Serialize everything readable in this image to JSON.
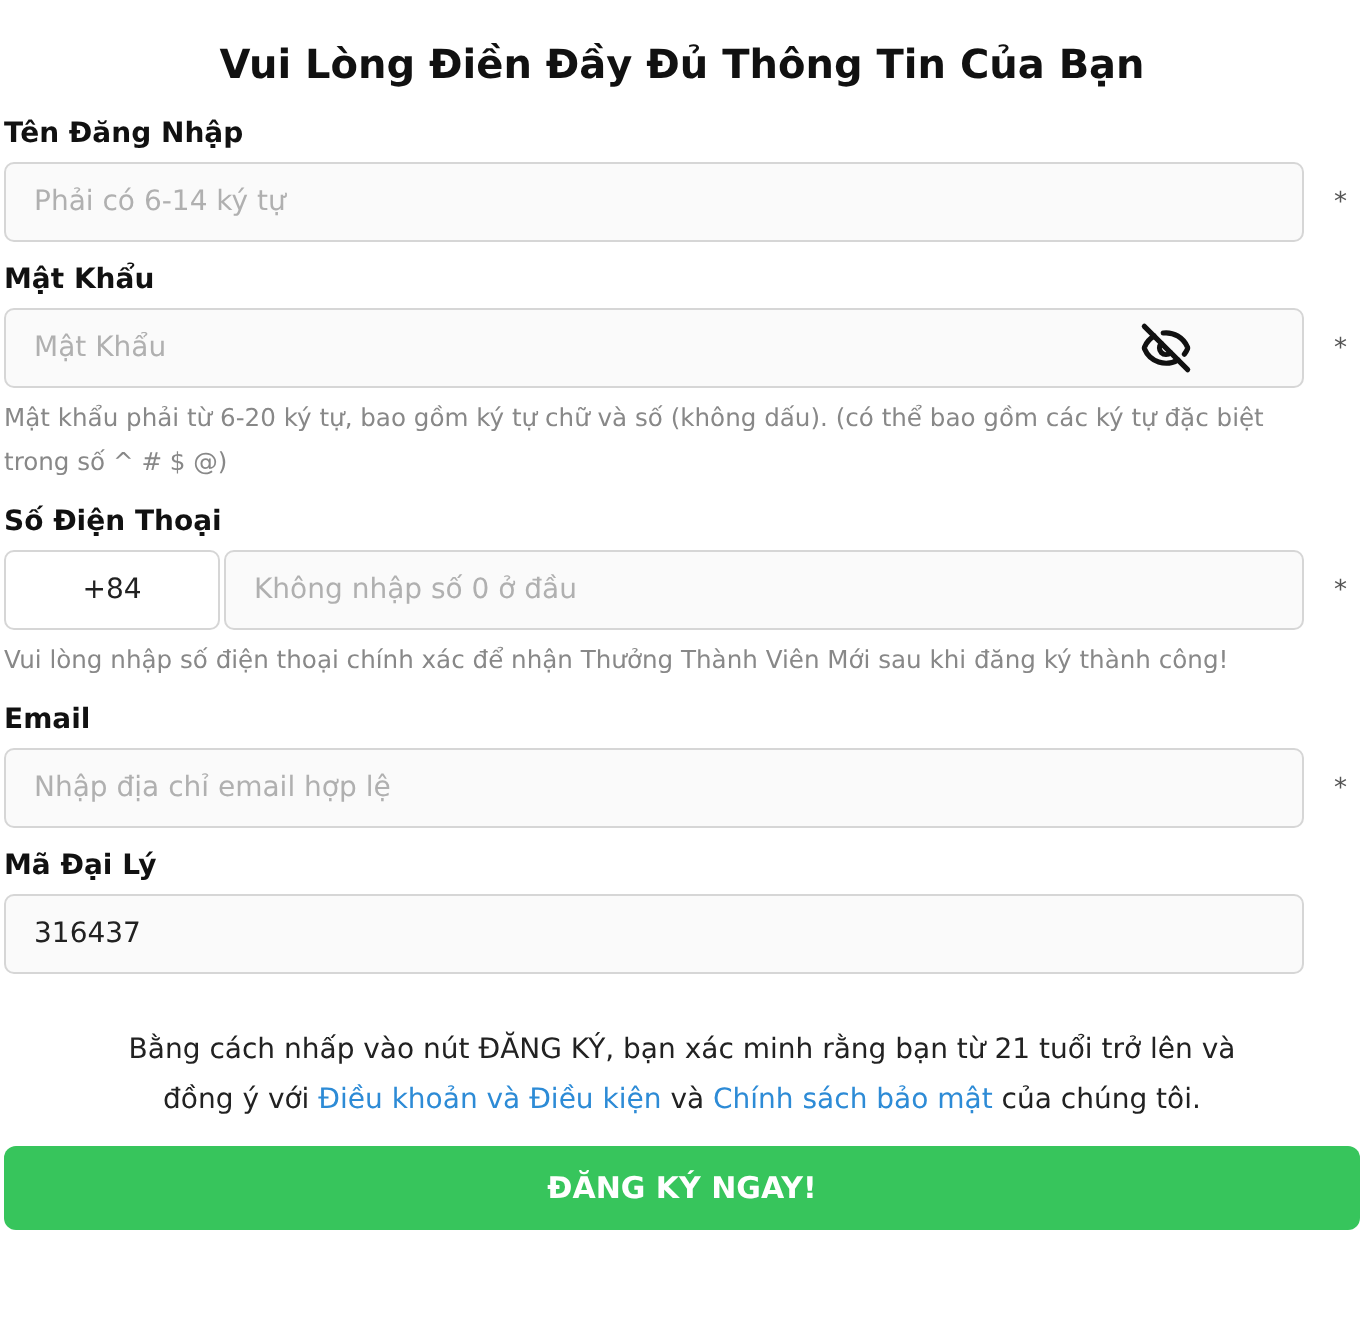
{
  "title": "Vui Lòng Điền Đầy Đủ Thông Tin Của Bạn",
  "fields": [
    {
      "kind": "text",
      "label": "Tên Đăng Nhập",
      "placeholder": "Phải có 6-14 ký tự",
      "required": true,
      "required_mark": "*"
    },
    {
      "kind": "password",
      "label": "Mật Khẩu",
      "placeholder": "Mật Khẩu",
      "required": true,
      "required_mark": "*",
      "hint": "Mật khẩu phải từ 6-20 ký tự, bao gồm ký tự chữ và số (không dấu). (có thể bao gồm các ký tự đặc biệt trong số ^ # $ @)"
    },
    {
      "kind": "phone",
      "label": "Số Điện Thoại",
      "prefix": "+84",
      "placeholder": "Không nhập số 0 ở đầu",
      "required": true,
      "required_mark": "*",
      "hint": "Vui lòng nhập số điện thoại chính xác để nhận Thưởng Thành Viên Mới sau khi đăng ký thành công!"
    },
    {
      "kind": "text",
      "label": "Email",
      "placeholder": "Nhập địa chỉ email hợp lệ",
      "required": true,
      "required_mark": "*"
    },
    {
      "kind": "text",
      "label": "Mã Đại Lý",
      "value": "316437",
      "required": false
    }
  ],
  "terms": [
    {
      "kind": "text",
      "text": "Bằng cách nhấp vào nút ĐĂNG KÝ, bạn xác minh rằng bạn từ 21 tuổi trở lên và đồng ý với "
    },
    {
      "kind": "link",
      "text": "Điều khoản và Điều kiện"
    },
    {
      "kind": "text",
      "text": " và "
    },
    {
      "kind": "link",
      "text": "Chính sách bảo mật"
    },
    {
      "kind": "text",
      "text": " của chúng tôi."
    }
  ],
  "submit": "ĐĂNG KÝ NGAY!"
}
